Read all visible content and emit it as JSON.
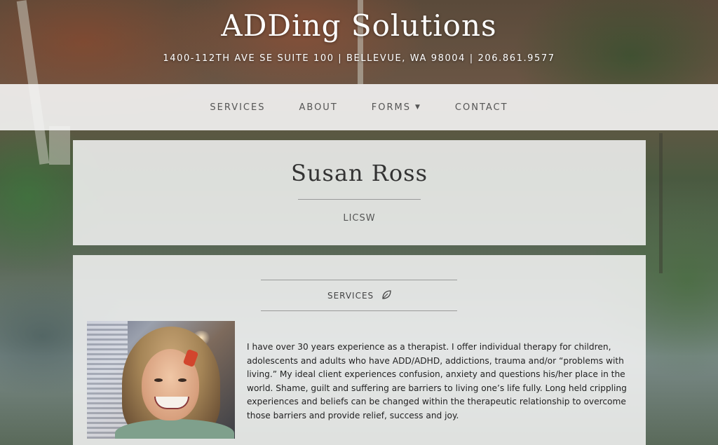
{
  "site": {
    "title": "ADDing Solutions",
    "address": "1400-112TH AVE SE SUITE 100 | BELLEVUE, WA 98004 | 206.861.9577"
  },
  "nav": {
    "items": [
      {
        "label": "SERVICES"
      },
      {
        "label": "ABOUT"
      },
      {
        "label": "FORMS"
      },
      {
        "label": "CONTACT"
      }
    ]
  },
  "profile": {
    "name": "Susan Ross",
    "credential": "LICSW"
  },
  "services": {
    "heading": "SERVICES",
    "icon": "leaf-icon",
    "bio": "I have over 30 years experience as a therapist. I offer individual therapy for children, adolescents and adults who have ADD/ADHD, addictions, trauma and/or “problems with living.” My ideal client experiences confusion, anxiety and questions his/her place in the world. Shame, guilt and suffering are barriers to living one’s life fully. Long held crippling experiences and beliefs can be changed within the therapeutic relationship to overcome those barriers and provide relief, success and joy."
  },
  "colors": {
    "nav_bg": "#f5f5f5",
    "panel_bg": "#f5f5f5",
    "text_dark": "#333333",
    "text_muted": "#555555"
  }
}
